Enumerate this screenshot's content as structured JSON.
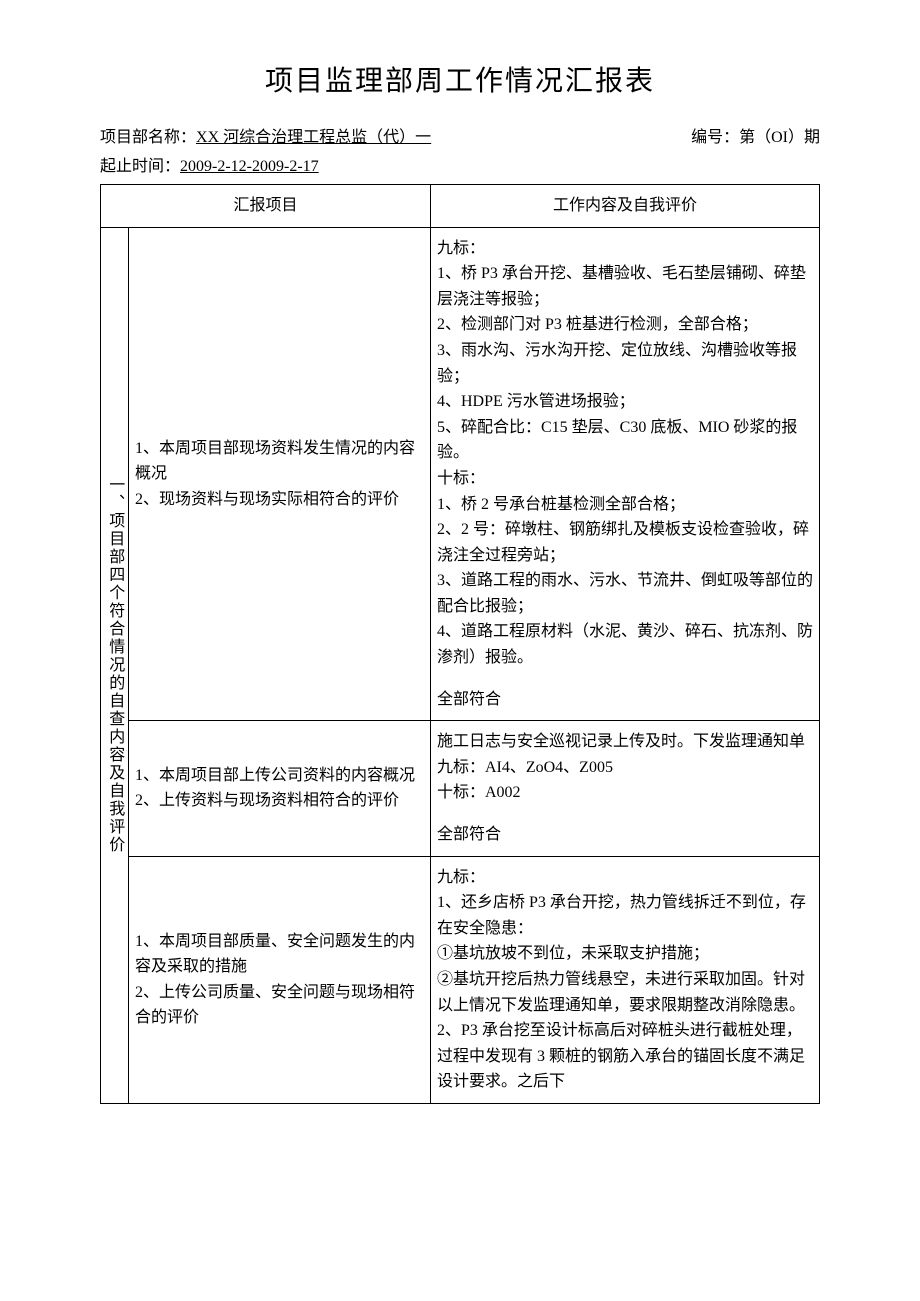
{
  "title": "项目监理部周工作情况汇报表",
  "meta": {
    "dept_label": "项目部名称：",
    "dept_value": "XX 河综合治理工程总监（代）一",
    "issue_label": "编号：第（OI）期",
    "period_label": "起止时间：",
    "period_value": "2009-2-12-2009-2-17"
  },
  "headers": {
    "left": "汇报项目",
    "right": "工作内容及自我评价"
  },
  "section_label": "一、项目部四个符合情况的自查内容及自我评价",
  "rows": [
    {
      "left": "1、本周项目部现场资料发生情况的内容概况\n2、现场资料与现场实际相符合的评价",
      "right_main": "九标：\n1、桥 P3 承台开挖、基槽验收、毛石垫层铺砌、碎垫层浇注等报验；\n2、检测部门对 P3 桩基进行检测，全部合格；\n3、雨水沟、污水沟开挖、定位放线、沟槽验收等报验；\n4、HDPE 污水管进场报验；\n5、碎配合比：C15 垫层、C30 底板、MIO 砂浆的报验。\n十标：\n1、桥 2 号承台桩基检测全部合格；\n2、2 号：碎墩柱、钢筋绑扎及模板支设检查验收，碎浇注全过程旁站；\n3、道路工程的雨水、污水、节流井、倒虹吸等部位的配合比报验；\n4、道路工程原材料（水泥、黄沙、碎石、抗冻剂、防渗剂）报验。",
      "right_eval": "全部符合"
    },
    {
      "left": "1、本周项目部上传公司资料的内容概况\n2、上传资料与现场资料相符合的评价",
      "right_main": "施工日志与安全巡视记录上传及时。下发监理通知单\n九标：AI4、ZoO4、Z005\n十标：A002",
      "right_eval": "全部符合"
    },
    {
      "left": "1、本周项目部质量、安全问题发生的内容及采取的措施\n2、上传公司质量、安全问题与现场相符合的评价",
      "right_main": "九标：\n1、还乡店桥 P3 承台开挖，热力管线拆迁不到位，存在安全隐患：\n①基坑放坡不到位，未采取支护措施；\n②基坑开挖后热力管线悬空，未进行采取加固。针对以上情况下发监理通知单，要求限期整改消除隐患。\n2、P3 承台挖至设计标高后对碎桩头进行截桩处理，过程中发现有 3 颗桩的钢筋入承台的锚固长度不满足设计要求。之后下"
    }
  ]
}
